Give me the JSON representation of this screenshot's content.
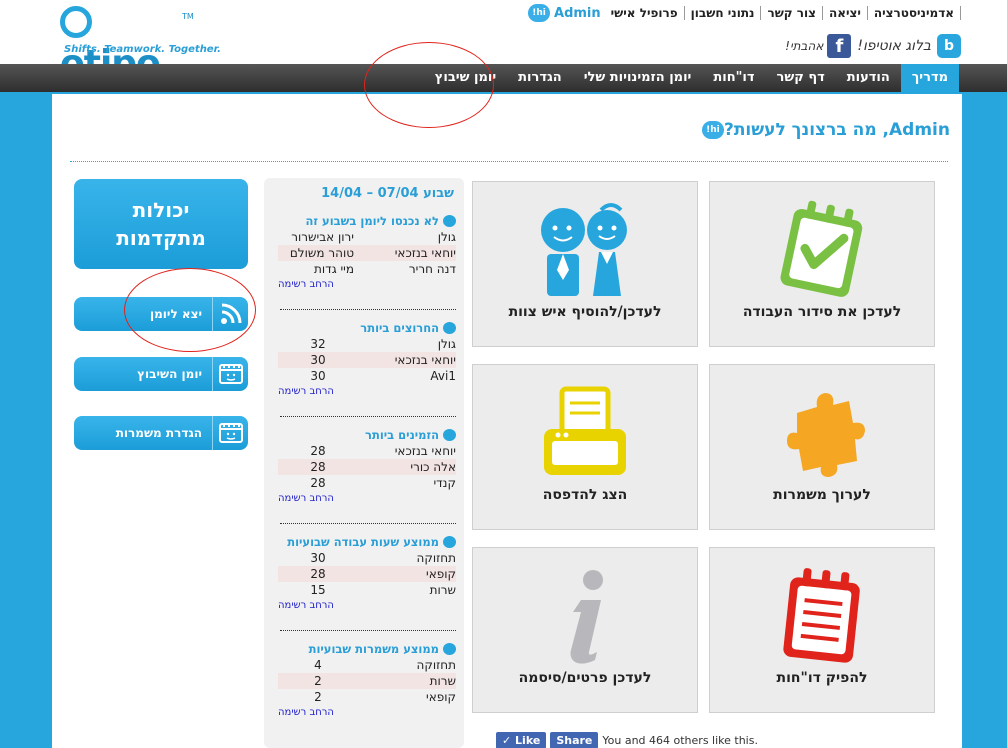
{
  "logo": {
    "brand": "otipo",
    "tm": "TM",
    "tagline": "Shifts. Teamwork. Together."
  },
  "header": {
    "hi": "hi!",
    "admin_name": "Admin",
    "links": [
      "פרופיל אישי",
      "נתוני חשבון",
      "צור קשר",
      "יציאה",
      "אדמיניסטרציה"
    ],
    "blog_icon": "b",
    "blog_label": "בלוג אוטיפו!",
    "fb_icon": "f",
    "like_us": "אהבתי!"
  },
  "nav": {
    "items": [
      "יומן שיבוץ",
      "הגדרות",
      "יומן הזמינויות שלי",
      "דו\"חות",
      "דף קשר",
      "הודעות",
      "מדריך"
    ],
    "active_index": 6
  },
  "greeting": {
    "hi": "hi!",
    "text": "Admin, מה ברצונך לעשות?"
  },
  "sidebar": {
    "advanced": [
      "יכולות",
      "מתקדמות"
    ],
    "buttons": [
      "יצא ליומן",
      "יומן השיבוץ",
      "הגדרת משמרות"
    ],
    "icons": [
      "rss-icon",
      "calendar-icon",
      "calendar-icon"
    ]
  },
  "stats": {
    "week_title": "שבוע 07/04 – 14/04",
    "more_label": "הרחב רשימה",
    "blocks": [
      {
        "title": "לא נכנסו ליומן בשבוע זה",
        "rows": [
          [
            "גולן",
            "ירון אבישרור"
          ],
          [
            "יוחאי בנזכאי",
            "טוהר משולם"
          ],
          [
            "דנה חריר",
            "מיי גדות"
          ]
        ]
      },
      {
        "title": "החרוצים ביותר",
        "rows": [
          [
            "גולן",
            "32"
          ],
          [
            "יוחאי בנזכאי",
            "30"
          ],
          [
            "Avi1",
            "30"
          ]
        ]
      },
      {
        "title": "הזמינים ביותר",
        "rows": [
          [
            "יוחאי בנזכאי",
            "28"
          ],
          [
            "אלה כורי",
            "28"
          ],
          [
            "קנדי",
            "28"
          ]
        ]
      },
      {
        "title": "ממוצע שעות עבודה שבועיות",
        "rows": [
          [
            "תחזוקה",
            "30"
          ],
          [
            "קופאי",
            "28"
          ],
          [
            "שרות",
            "15"
          ]
        ]
      },
      {
        "title": "ממוצע משמרות שבועיות",
        "rows": [
          [
            "תחזוקה",
            "4"
          ],
          [
            "שרות",
            "2"
          ],
          [
            "קופאי",
            "2"
          ]
        ]
      }
    ]
  },
  "tiles": [
    {
      "label": "לעדכן את סידור העבודה",
      "icon": "clipboard-check-icon"
    },
    {
      "label": "לעדכן/להוסיף איש צוות",
      "icon": "team-people-icon"
    },
    {
      "label": "לערוך משמרות",
      "icon": "puzzle-icon"
    },
    {
      "label": "הצג להדפסה",
      "icon": "printer-icon"
    },
    {
      "label": "להפיק דו\"חות",
      "icon": "report-notepad-icon"
    },
    {
      "label": "לעדכן פרטים/סיסמה",
      "icon": "info-icon"
    }
  ],
  "likebar": {
    "like": "Like",
    "share": "Share",
    "text": "You and 464 others like this."
  },
  "colors": {
    "brand": "#27a6dd",
    "nav_bg": "#333333",
    "annotation": "#e0231b"
  }
}
